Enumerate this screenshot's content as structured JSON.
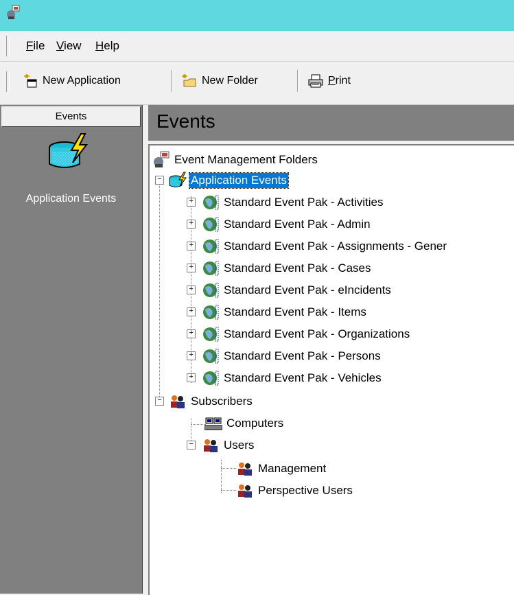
{
  "menu": {
    "file": {
      "key": "F",
      "rest": "ile"
    },
    "view": {
      "key": "V",
      "rest": "iew"
    },
    "help": {
      "key": "H",
      "rest": "elp"
    }
  },
  "toolbar": {
    "new_application": "New Application",
    "new_folder": "New Folder",
    "print_key": "P",
    "print_rest": "rint"
  },
  "left_pane": {
    "header": "Events",
    "item_label": "Application Events"
  },
  "right_pane": {
    "title": "Events"
  },
  "tree": {
    "root": "Event Management Folders",
    "application_events": "Application Events",
    "event_paks": [
      "Standard Event Pak - Activities",
      "Standard Event Pak - Admin",
      "Standard Event Pak - Assignments - Gener",
      "Standard Event Pak - Cases",
      "Standard Event Pak - eIncidents",
      "Standard Event Pak - Items",
      "Standard Event Pak - Organizations",
      "Standard Event Pak - Persons",
      "Standard Event Pak - Vehicles"
    ],
    "subscribers": "Subscribers",
    "computers": "Computers",
    "users": "Users",
    "management": "Management",
    "perspective_users": "Perspective Users"
  }
}
